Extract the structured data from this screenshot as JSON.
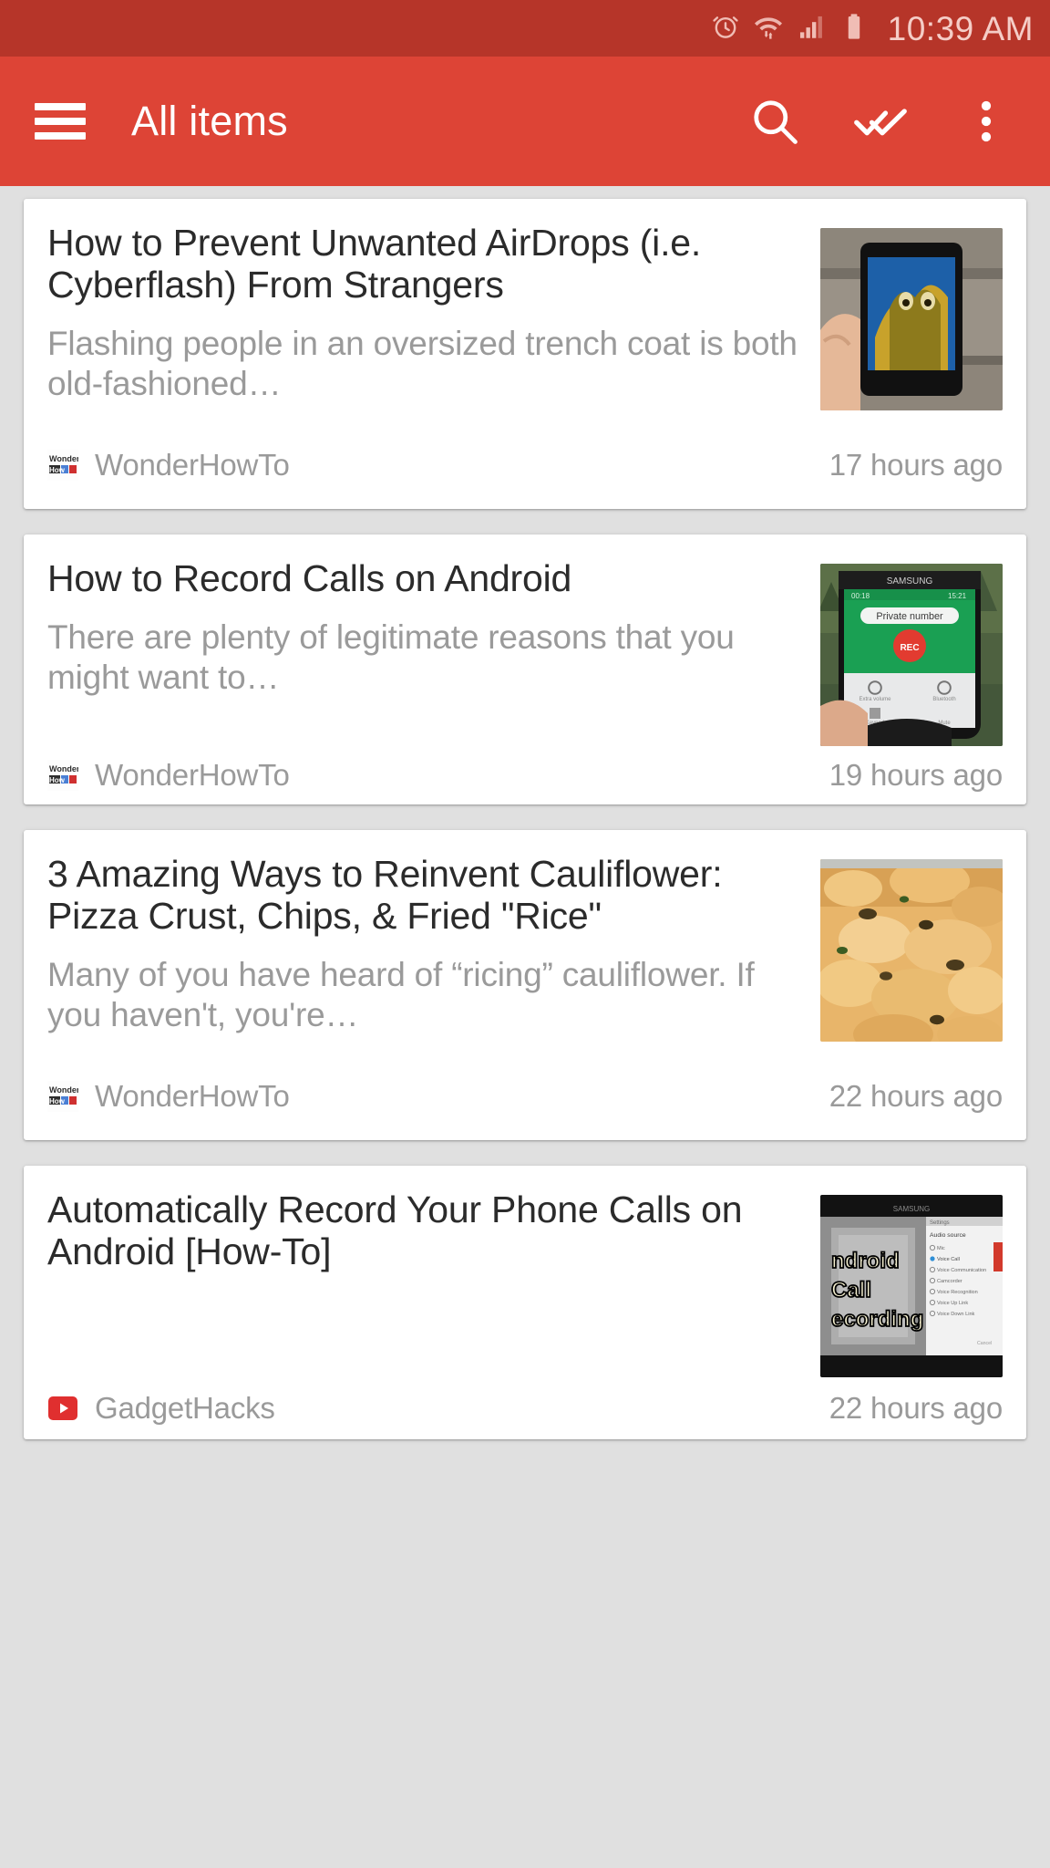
{
  "status_bar": {
    "time": "10:39 AM",
    "icons": [
      "alarm-icon",
      "wifi-icon",
      "signal-icon",
      "battery-icon"
    ],
    "background_color": "#b63529",
    "text_color": "#f5cdc7"
  },
  "toolbar": {
    "title": "All items",
    "menu_icon": "hamburger-menu-icon",
    "actions": [
      {
        "name": "search-icon",
        "label": "Search"
      },
      {
        "name": "mark-all-read-icon",
        "label": "Mark all as read"
      },
      {
        "name": "overflow-menu-icon",
        "label": "More options"
      }
    ],
    "background_color": "#dd4436"
  },
  "feed": {
    "items": [
      {
        "title": "How to Prevent Unwanted AirDrops (i.e. Cyberflash) From Strangers",
        "snippet": "Flashing people in an oversized trench coat is both old-fashioned…",
        "source": "WonderHowTo",
        "source_icon": "wonderhowto-favicon",
        "timestamp": "17 hours ago",
        "thumbnail": "hand-holding-phone-on-bench"
      },
      {
        "title": "How to Record Calls on Android",
        "snippet": "There are plenty of legitimate reasons that you might want to…",
        "source": "WonderHowTo",
        "source_icon": "wonderhowto-favicon",
        "timestamp": "19 hours ago",
        "thumbnail": "samsung-phone-private-number-rec"
      },
      {
        "title": "3 Amazing Ways to Reinvent Cauliflower: Pizza Crust, Chips, & Fried \"Rice\"",
        "snippet": "Many of you have heard of “ricing” cauliflower. If you haven't, you're…",
        "source": "WonderHowTo",
        "source_icon": "wonderhowto-favicon",
        "timestamp": "22 hours ago",
        "thumbnail": "baked-cauliflower-closeup"
      },
      {
        "title": "Automatically Record Your Phone Calls on Android [How-To]",
        "snippet": "",
        "source": "GadgetHacks",
        "source_icon": "youtube-icon",
        "timestamp": "22 hours ago",
        "thumbnail": "android-call-recording-video"
      }
    ]
  },
  "colors": {
    "accent": "#dd4436",
    "status_bar": "#b63529",
    "page_background": "#e0e0e0",
    "card_background": "#ffffff",
    "title_text": "#2b2b2b",
    "secondary_text": "#9a9a9a",
    "youtube_red": "#e02f2f"
  }
}
